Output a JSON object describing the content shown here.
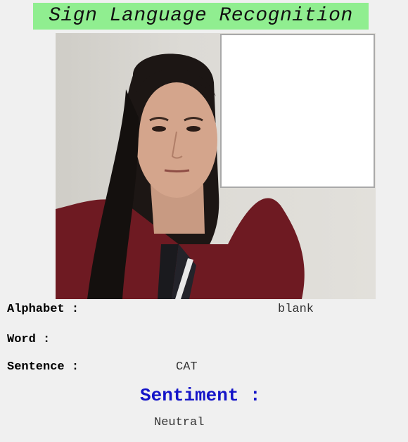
{
  "title": "Sign Language Recognition",
  "fields": {
    "alphabet_label": "Alphabet :",
    "alphabet_value": "blank",
    "word_label": "Word :",
    "word_value": "",
    "sentence_label": "Sentence :",
    "sentence_value": "CAT"
  },
  "sentiment": {
    "label": "Sentiment :",
    "value": "Neutral"
  },
  "colors": {
    "title_background": "#90ee90",
    "sentiment_label": "#1414c8",
    "app_background": "#f0f0f0"
  }
}
